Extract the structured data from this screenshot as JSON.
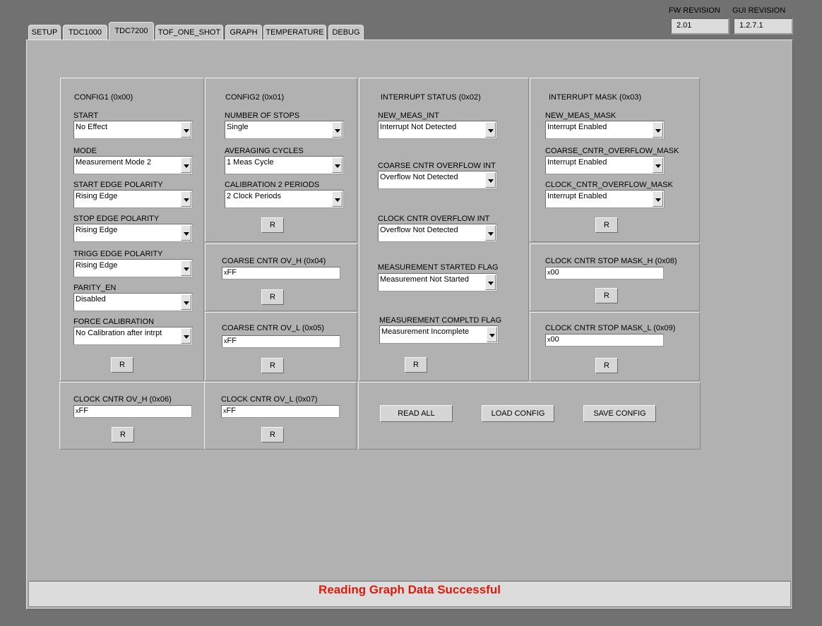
{
  "tabs": [
    {
      "label": "SETUP",
      "active": false
    },
    {
      "label": "TDC1000",
      "active": false
    },
    {
      "label": "TDC7200",
      "active": true
    },
    {
      "label": "TOF_ONE_SHOT",
      "active": false
    },
    {
      "label": "GRAPH",
      "active": false
    },
    {
      "label": "TEMPERATURE",
      "active": false
    },
    {
      "label": "DEBUG",
      "active": false
    }
  ],
  "revision": {
    "fw_label": "FW REVISION",
    "fw_value": "2.01",
    "gui_label": "GUI REVISION",
    "gui_value": "1.2.7.1"
  },
  "config1": {
    "title": "CONFIG1 (0x00)",
    "fields": [
      {
        "label": "START",
        "value": "No Effect"
      },
      {
        "label": "MODE",
        "value": "Measurement Mode 2"
      },
      {
        "label": "START EDGE POLARITY",
        "value": "Rising Edge"
      },
      {
        "label": "STOP EDGE POLARITY",
        "value": "Rising Edge"
      },
      {
        "label": "TRIGG EDGE POLARITY",
        "value": "Rising Edge"
      },
      {
        "label": "PARITY_EN",
        "value": "Disabled"
      },
      {
        "label": "FORCE CALIBRATION",
        "value": "No Calibration after intrpt"
      }
    ],
    "reset": "R"
  },
  "config2": {
    "title": "CONFIG2 (0x01)",
    "fields": [
      {
        "label": "NUMBER OF STOPS",
        "value": "Single"
      },
      {
        "label": "AVERAGING CYCLES",
        "value": "1 Meas Cycle"
      },
      {
        "label": "CALIBRATION 2 PERIODS",
        "value": "2 Clock Periods"
      }
    ],
    "reset": "R"
  },
  "interrupt_status": {
    "title": "INTERRUPT STATUS (0x02)",
    "fields": [
      {
        "label": "NEW_MEAS_INT",
        "value": "Interrupt Not Detected"
      },
      {
        "label": "COARSE CNTR OVERFLOW INT",
        "value": "Overflow Not Detected"
      },
      {
        "label": "CLOCK CNTR OVERFLOW INT",
        "value": "Overflow Not Detected"
      },
      {
        "label": "MEASUREMENT STARTED FLAG",
        "value": "Measurement Not Started"
      },
      {
        "label": "MEASUREMENT COMPLTD FLAG",
        "value": "Measurement Incomplete"
      }
    ],
    "reset": "R"
  },
  "interrupt_mask": {
    "title": "INTERRUPT MASK (0x03)",
    "fields": [
      {
        "label": "NEW_MEAS_MASK",
        "value": "Interrupt Enabled"
      },
      {
        "label": "COARSE_CNTR_OVERFLOW_MASK",
        "value": "Interrupt Enabled"
      },
      {
        "label": "CLOCK_CNTR_OVERFLOW_MASK",
        "value": "Interrupt Enabled"
      }
    ],
    "reset": "R"
  },
  "coarse_ov_h": {
    "label": "COARSE CNTR OV_H (0x04)",
    "prefix": "x",
    "value": "FF",
    "reset": "R"
  },
  "coarse_ov_l": {
    "label": "COARSE CNTR OV_L (0x05)",
    "prefix": "x",
    "value": "FF",
    "reset": "R"
  },
  "clock_ov_h": {
    "label": "CLOCK CNTR OV_H (0x06)",
    "prefix": "x",
    "value": "FF",
    "reset": "R"
  },
  "clock_ov_l": {
    "label": "CLOCK CNTR OV_L (0x07)",
    "prefix": "x",
    "value": "FF",
    "reset": "R"
  },
  "clock_stop_mask_h": {
    "label": "CLOCK CNTR STOP MASK_H (0x08)",
    "prefix": "x",
    "value": "00",
    "reset": "R"
  },
  "clock_stop_mask_l": {
    "label": "CLOCK CNTR STOP MASK_L (0x09)",
    "prefix": "x",
    "value": "00",
    "reset": "R"
  },
  "actions": {
    "read_all": "READ ALL",
    "load_config": "LOAD CONFIG",
    "save_config": "SAVE CONFIG"
  },
  "status": {
    "message": "Reading Graph Data Successful",
    "color": "#e01a0a"
  },
  "colors": {
    "background": "#717171",
    "panel": "#b1b1b1"
  }
}
